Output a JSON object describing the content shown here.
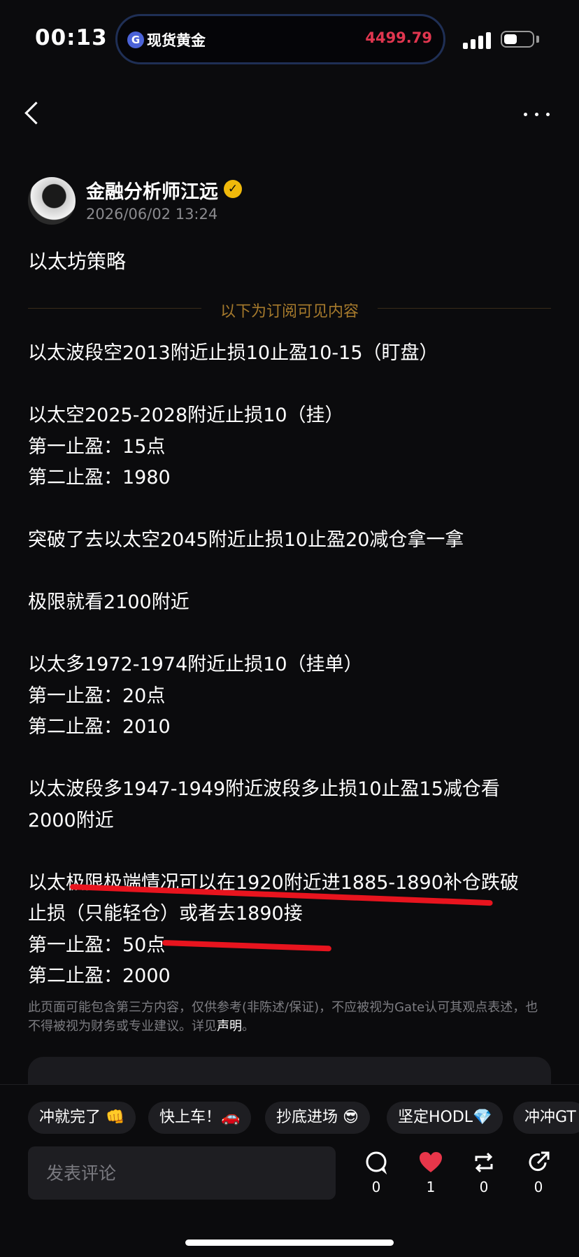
{
  "status_bar": {
    "time": "00:13",
    "ticker_label": "现货黄金",
    "ticker_price": "4499.79",
    "ticker_icon": "G"
  },
  "nav": {
    "back_icon": "chevron-left-icon",
    "more_icon": "ellipsis-icon"
  },
  "author": {
    "name": "金融分析师江远",
    "verified_icon": "verified-badge-icon",
    "verified_glyph": "✓",
    "timestamp": "2026/06/02 13:24"
  },
  "post": {
    "title": "以太坊策略",
    "subscription_divider": "以下为订阅可见内容",
    "lines": [
      "以太波段空2013附近止损10止盈10-15（盯盘）",
      "",
      "以太空2025-2028附近止损10（挂）",
      "第一止盈：15点",
      "第二止盈：1980",
      "",
      "突破了去以太空2045附近止损10止盈20减仓拿一拿",
      "",
      "极限就看2100附近",
      "",
      "以太多1972-1974附近止损10（挂单）",
      "第一止盈：20点",
      "第二止盈：2010",
      "",
      "以太波段多1947-1949附近波段多止损10止盈15减仓看",
      "2000附近",
      "",
      "以太极限极端情况可以在1920附近进1885-1890补仓跌破",
      "止损（只能轻仓）或者去1890接",
      "第一止盈：50点",
      "第二止盈：2000"
    ],
    "disclaimer_text": "此页面可能包含第三方内容，仅供参考(非陈述/保证)，不应被视为Gate认可其观点表述，也不得被视为财务或专业建议。详见",
    "disclaimer_link": "声明",
    "disclaimer_end": "。"
  },
  "quick_reactions": [
    "冲就完了 👊",
    "快上车！🚗",
    "抄底进场 😎",
    "坚定HODL💎",
    "冲冲GT"
  ],
  "comment_box": {
    "placeholder": "发表评论"
  },
  "actions": {
    "comment": {
      "icon": "comment-bubble-icon",
      "count": "0"
    },
    "like": {
      "icon": "heart-icon",
      "count": "1",
      "color": "#e8364a"
    },
    "repost": {
      "icon": "repost-icon",
      "count": "0"
    },
    "share": {
      "icon": "share-icon",
      "count": "0"
    }
  },
  "colors": {
    "background": "#0b0b0d",
    "accent_gold": "#a67a2c",
    "price_red": "#e0364f",
    "annotation_red": "#e8141e"
  }
}
